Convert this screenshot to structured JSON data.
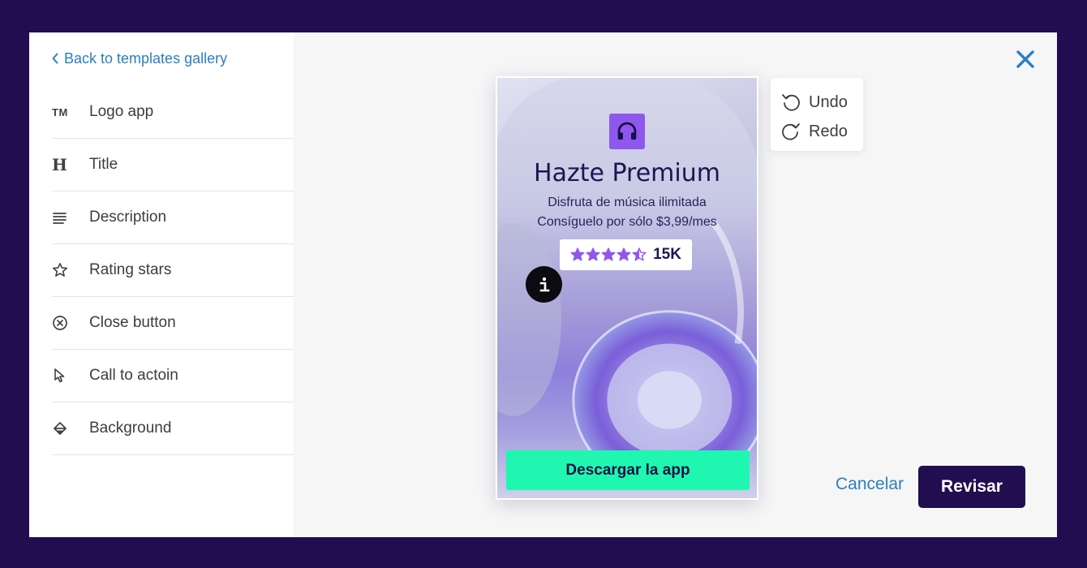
{
  "sidebar": {
    "back_label": "Back to templates gallery",
    "items": [
      {
        "label": "Logo app",
        "icon": "trademark-icon",
        "glyph": "TM"
      },
      {
        "label": "Title",
        "icon": "heading-icon",
        "glyph": "H"
      },
      {
        "label": "Description",
        "icon": "text-lines-icon"
      },
      {
        "label": "Rating stars",
        "icon": "star-outline-icon"
      },
      {
        "label": "Close button",
        "icon": "circle-x-icon"
      },
      {
        "label": "Call to actoin",
        "icon": "cursor-pointer-icon"
      },
      {
        "label": "Background",
        "icon": "paint-bucket-icon"
      }
    ]
  },
  "ad": {
    "title": "Hazte Premium",
    "description_line1": "Disfruta de música ilimitada",
    "description_line2": "Consíguelo por sólo $3,99/mes",
    "rating_count": "15K",
    "rating_value": 4.5,
    "rating_max": 5,
    "cta_label": "Descargar la app",
    "logo_icon": "headphones-icon",
    "info_icon": "info-icon"
  },
  "history": {
    "undo_label": "Undo",
    "redo_label": "Redo"
  },
  "footer": {
    "cancel_label": "Cancelar",
    "review_label": "Revisar"
  },
  "colors": {
    "backdrop": "#220d50",
    "link": "#2d7ec0",
    "primary_button": "#220d50",
    "cta": "#1ff7b0",
    "app_logo": "#8f57ee",
    "star": "#8f57ee"
  }
}
